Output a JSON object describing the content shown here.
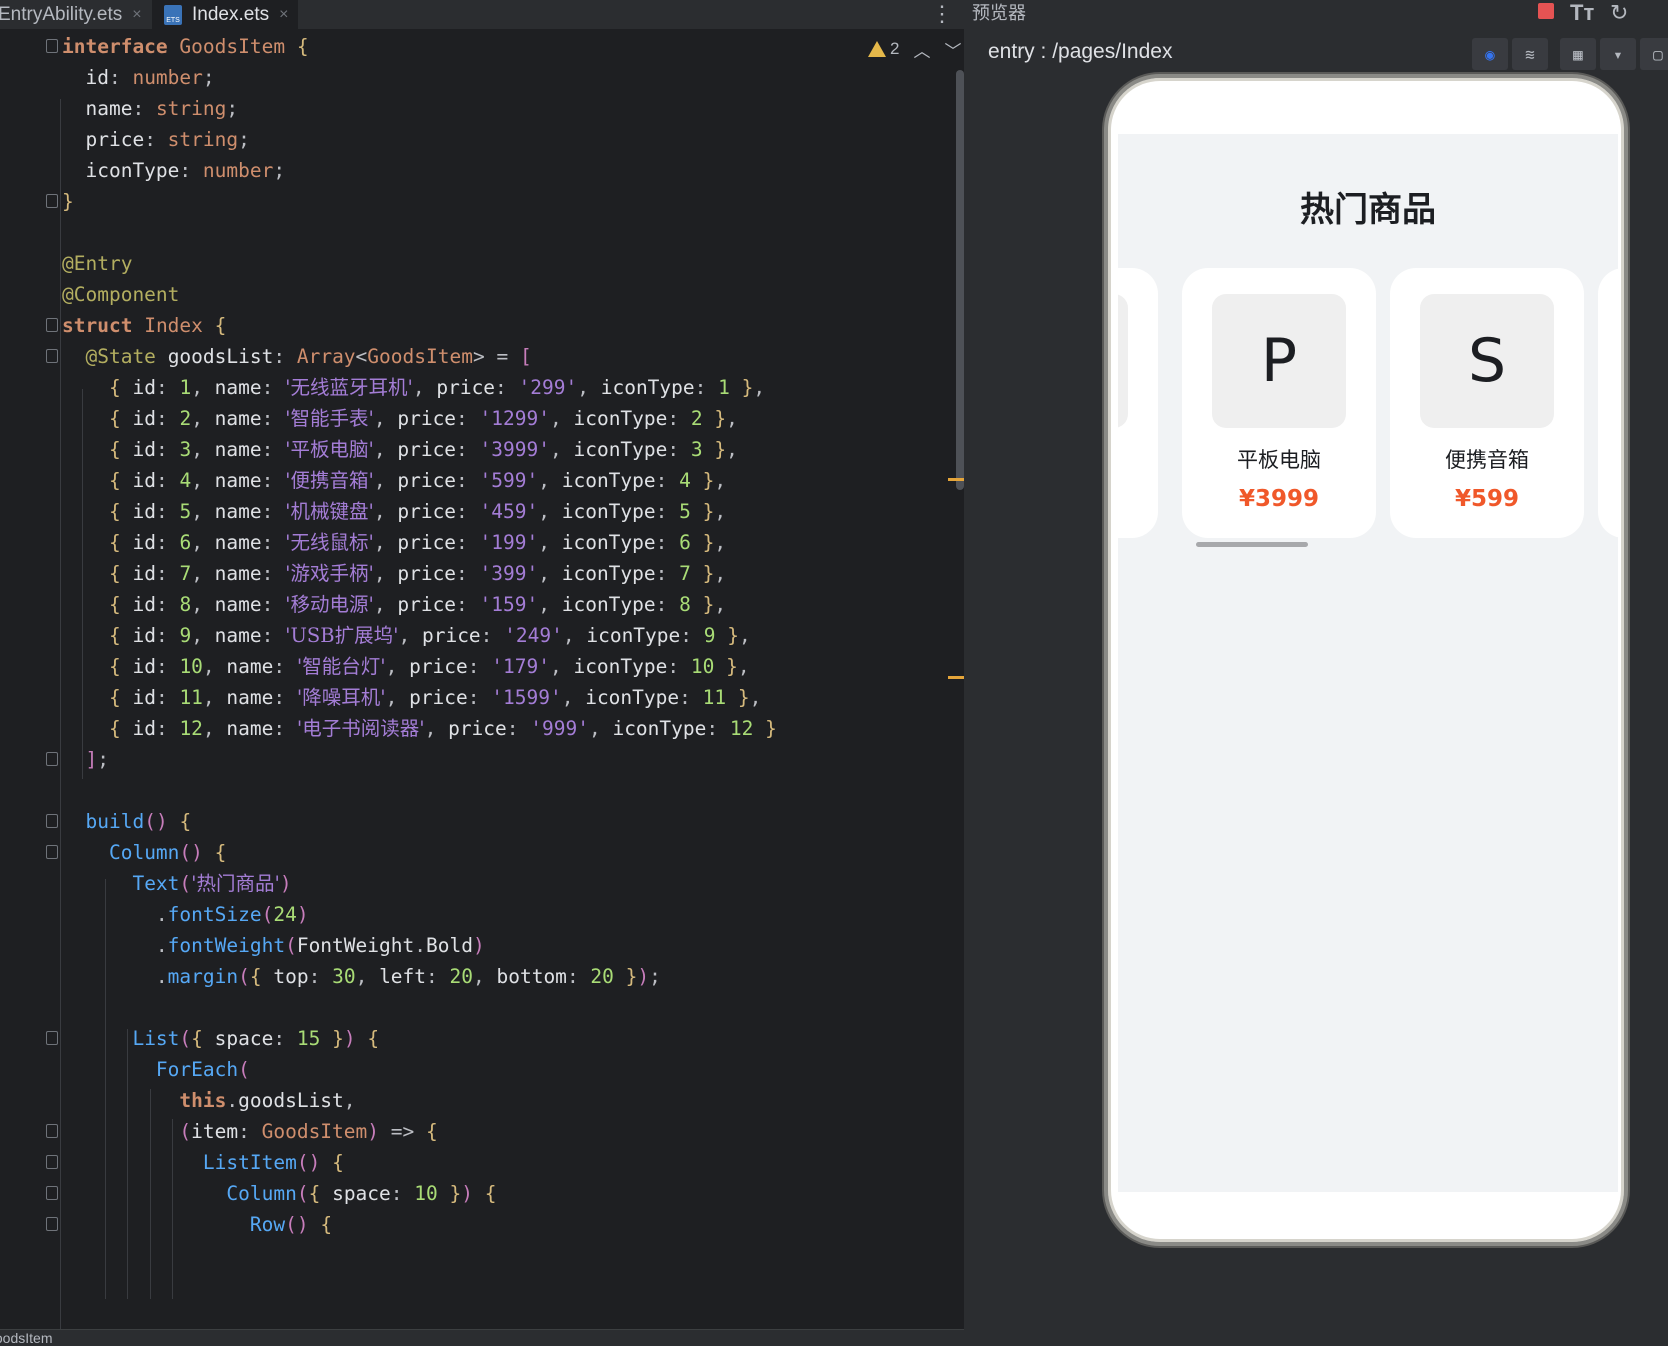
{
  "tabs": [
    {
      "label": "EntryAbility.ets",
      "close": "×"
    },
    {
      "label": "Index.ets",
      "close": "×"
    }
  ],
  "inspection": {
    "warnings": "2"
  },
  "code_lines": [
    "interface GoodsItem {",
    "  id: number;",
    "  name: string;",
    "  price: string;",
    "  iconType: number;",
    "}",
    "",
    "@Entry",
    "@Component",
    "struct Index {",
    "  @State goodsList: Array<GoodsItem> = [",
    "    { id: 1, name: '无线蓝牙耳机', price: '299', iconType: 1 },",
    "    { id: 2, name: '智能手表', price: '1299', iconType: 2 },",
    "    { id: 3, name: '平板电脑', price: '3999', iconType: 3 },",
    "    { id: 4, name: '便携音箱', price: '599', iconType: 4 },",
    "    { id: 5, name: '机械键盘', price: '459', iconType: 5 },",
    "    { id: 6, name: '无线鼠标', price: '199', iconType: 6 },",
    "    { id: 7, name: '游戏手柄', price: '399', iconType: 7 },",
    "    { id: 8, name: '移动电源', price: '159', iconType: 8 },",
    "    { id: 9, name: 'USB扩展坞', price: '249', iconType: 9 },",
    "    { id: 10, name: '智能台灯', price: '179', iconType: 10 },",
    "    { id: 11, name: '降噪耳机', price: '1599', iconType: 11 },",
    "    { id: 12, name: '电子书阅读器', price: '999', iconType: 12 }",
    "  ];",
    "",
    "  build() {",
    "    Column() {",
    "      Text('热门商品')",
    "        .fontSize(24)",
    "        .fontWeight(FontWeight.Bold)",
    "        .margin({ top: 30, left: 20, bottom: 20 });",
    "",
    "      List({ space: 15 }) {",
    "        ForEach(",
    "          this.goodsList,",
    "          (item: GoodsItem) => {",
    "            ListItem() {",
    "              Column({ space: 10 }) {",
    "                Row() {"
  ],
  "status_text": "GoodsItem",
  "preview": {
    "panel_title": "预览器",
    "route": "entry : /pages/Index",
    "font_icon": "Tт",
    "app_title": "热门商品",
    "cards": [
      {
        "letter": "",
        "name": "",
        "price": ""
      },
      {
        "letter": "P",
        "name": "平板电脑",
        "price": "¥3999"
      },
      {
        "letter": "S",
        "name": "便携音箱",
        "price": "¥599"
      }
    ]
  },
  "colors": {
    "editor_bg": "#1e1f22",
    "keyword": "#cf8e6d",
    "string": "#a47dd6",
    "number": "#2aacb8",
    "price_accent": "#f0582a"
  }
}
